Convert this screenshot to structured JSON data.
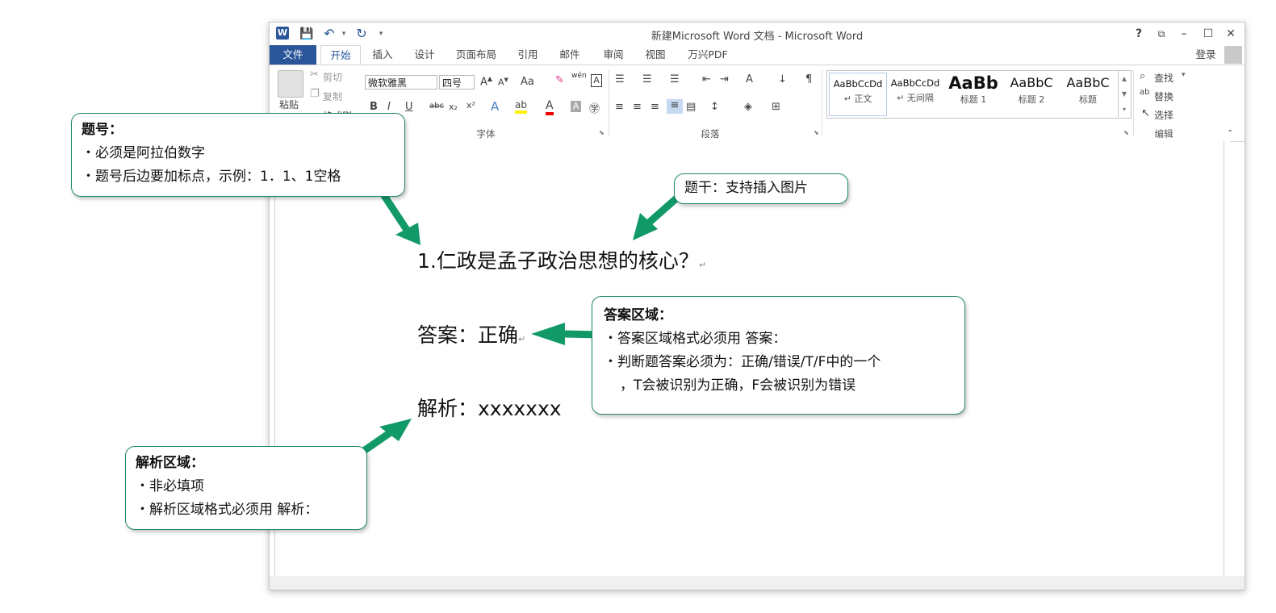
{
  "window": {
    "title": "新建Microsoft Word 文档 - Microsoft Word",
    "help": "?",
    "login": "登录",
    "logo": "W"
  },
  "quick_access": {
    "save_icon": "save-icon",
    "undo_icon": "undo-icon",
    "redo_icon": "redo-icon"
  },
  "tabs": [
    "文件",
    "开始",
    "插入",
    "设计",
    "页面布局",
    "引用",
    "邮件",
    "审阅",
    "视图",
    "万兴PDF"
  ],
  "ribbon": {
    "clipboard": {
      "paste": "粘贴",
      "cut": "剪切",
      "copy": "复制",
      "format_painter": "格式刷"
    },
    "font": {
      "label": "字体",
      "font_name": "微软雅黑",
      "font_size": "四号",
      "change_case": "Aa",
      "phonetic": "wén"
    },
    "paragraph": {
      "label": "段落"
    },
    "styles": {
      "items": [
        {
          "sample": "AaBbCcDd",
          "name": "↵ 正文"
        },
        {
          "sample": "AaBbCcDd",
          "name": "↵ 无间隔"
        },
        {
          "sample": "AaBb",
          "name": "标题 1"
        },
        {
          "sample": "AaBbC",
          "name": "标题 2"
        },
        {
          "sample": "AaBbC",
          "name": "标题"
        }
      ]
    },
    "editing": {
      "label": "编辑",
      "find": "查找",
      "replace": "替换",
      "select": "选择"
    }
  },
  "document": {
    "question": "1.仁政是孟子政治思想的核心？",
    "answer": "答案：正确",
    "analysis": "解析：xxxxxxx",
    "paragraph_mark": "↵"
  },
  "callouts": {
    "number": {
      "title": "题号：",
      "lines": [
        "・必须是阿拉伯数字",
        "・题号后边要加标点，示例：1．1、1空格"
      ]
    },
    "stem": {
      "title": "题干：支持插入图片"
    },
    "answer": {
      "title": "答案区域：",
      "lines": [
        "・答案区域格式必须用 答案：",
        "・判断题答案必须为：正确/错误/T/F中的一个",
        "，T会被识别为正确，F会被识别为错误"
      ]
    },
    "analysis": {
      "title": "解析区域：",
      "lines": [
        "・非必填项",
        "・解析区域格式必须用 解析："
      ]
    }
  },
  "colors": {
    "accent": "#2b579a",
    "callout_border": "#1f8a5e",
    "arrow": "#119a68"
  }
}
